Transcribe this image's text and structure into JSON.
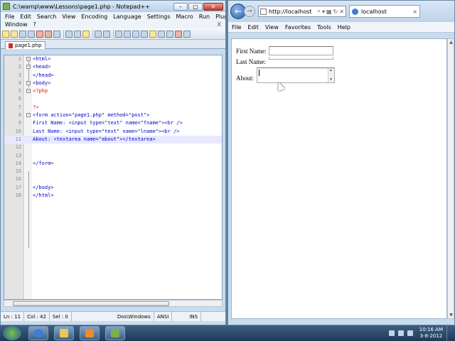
{
  "notepad": {
    "title": "C:\\wamp\\www\\Lessons\\page1.php - Notepad++",
    "menu": [
      "File",
      "Edit",
      "Search",
      "View",
      "Encoding",
      "Language",
      "Settings",
      "Macro",
      "Run",
      "Plugins"
    ],
    "menu2": [
      "Window",
      "?"
    ],
    "menu2_close": "X",
    "tab": "page1.php",
    "lines": [
      {
        "n": "1",
        "text": "<html>"
      },
      {
        "n": "2",
        "text": "<head>"
      },
      {
        "n": "3",
        "text": "</head>"
      },
      {
        "n": "4",
        "text": "<body>"
      },
      {
        "n": "5",
        "text": "<?php"
      },
      {
        "n": "6",
        "text": ""
      },
      {
        "n": "7",
        "text": "?>"
      },
      {
        "n": "8",
        "text": "<form action=\"page1.php\" method=\"post\">"
      },
      {
        "n": "9",
        "text": "First Name: <input type=\"text\" name=\"fname\"><br />"
      },
      {
        "n": "10",
        "text": "Last Name: <input type=\"text\" name=\"lname\"><br />"
      },
      {
        "n": "11",
        "text": "About: <textarea name=\"about\"></textarea>"
      },
      {
        "n": "12",
        "text": ""
      },
      {
        "n": "13",
        "text": ""
      },
      {
        "n": "14",
        "text": "</form>"
      },
      {
        "n": "15",
        "text": ""
      },
      {
        "n": "16",
        "text": ""
      },
      {
        "n": "17",
        "text": "</body>"
      },
      {
        "n": "18",
        "text": "</html>"
      }
    ],
    "status": {
      "ln": "Ln : 11",
      "col": "Col : 42",
      "sel": "Sel : 0",
      "eol": "Dos\\Windows",
      "enc": "ANSI",
      "mode": "INS"
    }
  },
  "browser": {
    "address": "http://localhost",
    "tab_title": "localhost",
    "tab_close": "×",
    "menu": [
      "File",
      "Edit",
      "View",
      "Favorites",
      "Tools",
      "Help"
    ],
    "form": {
      "first_label": "First Name:",
      "last_label": "Last Name:",
      "about_label": "About:"
    }
  },
  "taskbar": {
    "time": "10:16 AM",
    "date": "3-8-2012"
  }
}
